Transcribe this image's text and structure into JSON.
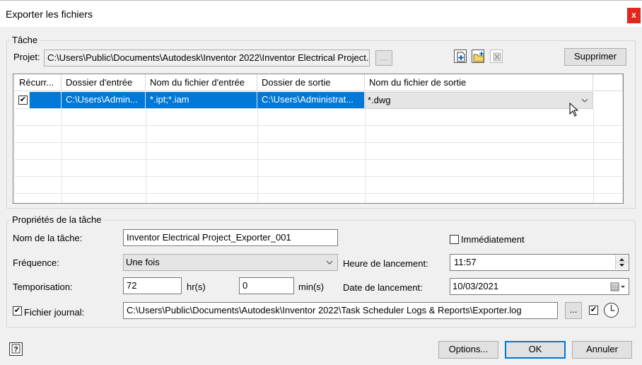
{
  "window": {
    "title": "Exporter les fichiers",
    "close_glyph": "x"
  },
  "task_group": {
    "legend": "Tâche",
    "project_label": "Projet:",
    "project_value": "C:\\Users\\Public\\Documents\\Autodesk\\Inventor 2022\\Inventor Electrical Project.",
    "browse_label": "...",
    "delete_label": "Supprimer",
    "columns": [
      "Récurr...",
      "Dossier d'entrée",
      "Nom du fichier d'entrée",
      "Dossier de sortie",
      "Nom du fichier de sortie"
    ],
    "rows": [
      {
        "recurring": true,
        "input_folder": "C:\\Users\\Admin...",
        "input_files": "*.ipt;*.iam",
        "output_folder": "C:\\Users\\Administrat...",
        "output_file": "*.dwg"
      }
    ]
  },
  "props_group": {
    "legend": "Propriétés de la tâche",
    "task_name_label": "Nom de la tâche:",
    "task_name_value": "Inventor Electrical Project_Exporter_001",
    "immediately_label": "Immédiatement",
    "immediately_checked": false,
    "frequency_label": "Fréquence:",
    "frequency_value": "Une fois",
    "start_time_label": "Heure de lancement:",
    "start_time_value": "11:57",
    "delay_label": "Temporisation:",
    "delay_hours": "72",
    "hours_unit": "hr(s)",
    "delay_minutes": "0",
    "minutes_unit": "min(s)",
    "start_date_label": "Date de lancement:",
    "start_date_value": "10/03/2021",
    "log_label": "Fichier journal:",
    "log_checked": true,
    "log_value": "C:\\Users\\Public\\Documents\\Autodesk\\Inventor 2022\\Task Scheduler Logs & Reports\\Exporter.log",
    "log_browse_label": "..."
  },
  "footer": {
    "options_label": "Options...",
    "ok_label": "OK",
    "cancel_label": "Annuler"
  },
  "colors": {
    "accent": "#0078d7",
    "close": "#e2271d"
  }
}
